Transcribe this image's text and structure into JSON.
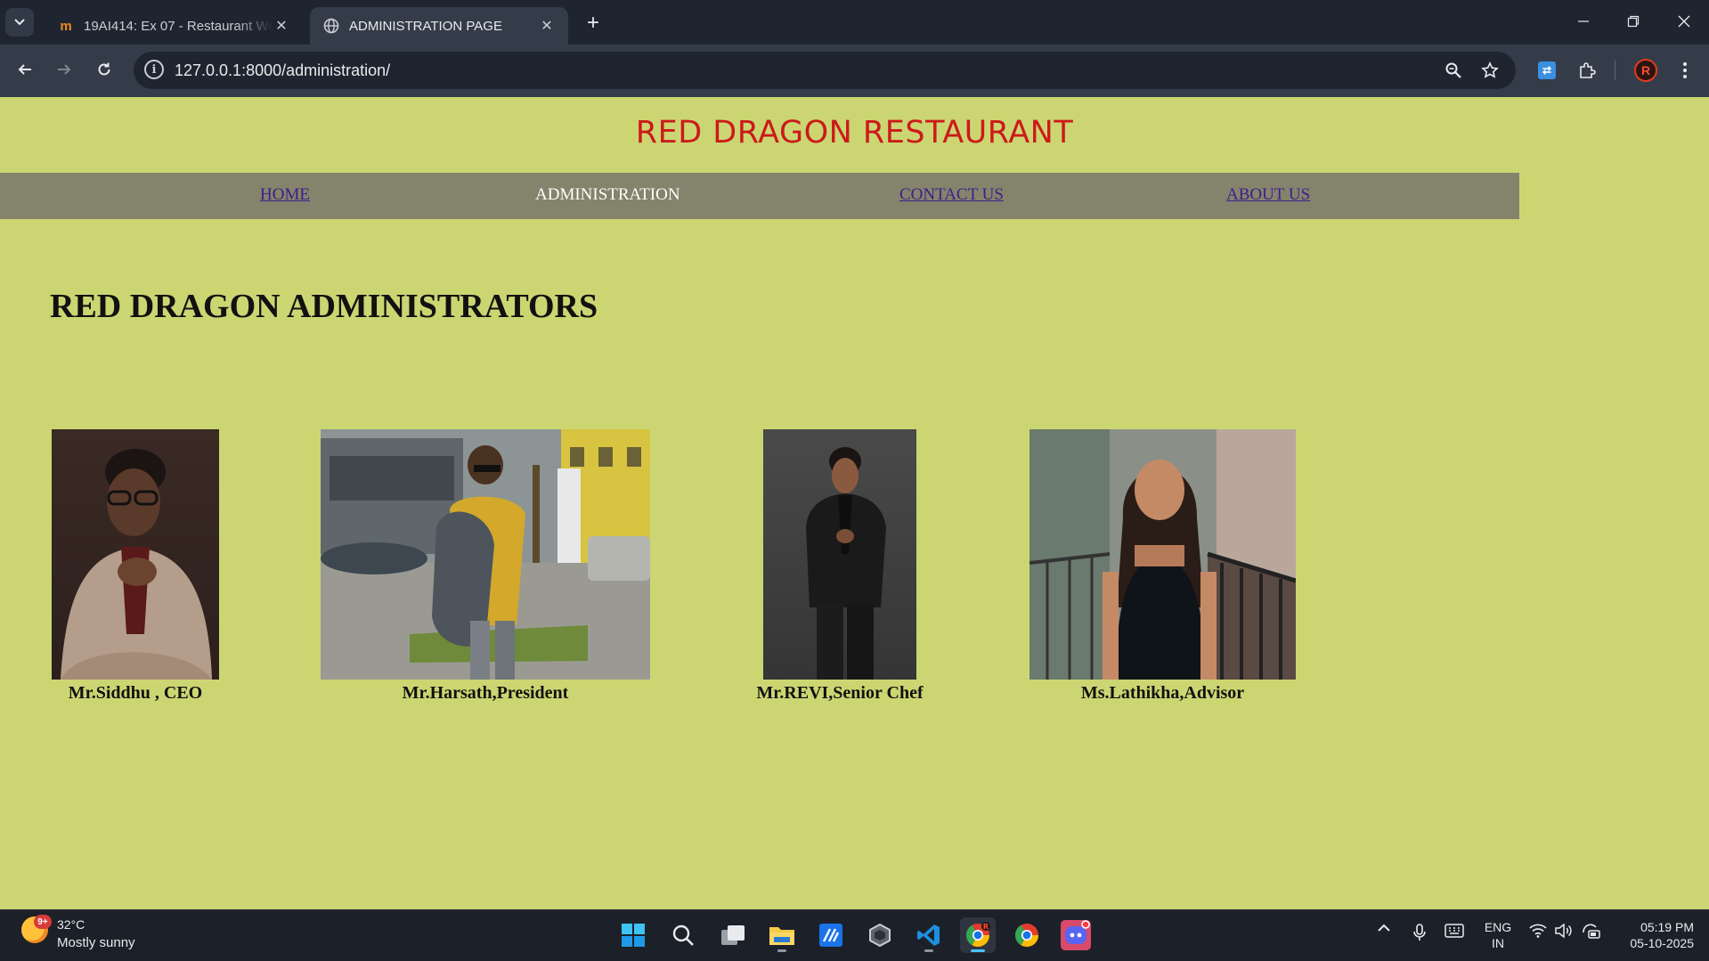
{
  "browser": {
    "tabs": [
      {
        "title": "19AI414: Ex 07 - Restaurant We",
        "favicon": "moodle-icon",
        "active": false
      },
      {
        "title": "ADMINISTRATION PAGE",
        "favicon": "globe-icon",
        "active": true
      }
    ],
    "url": "127.0.0.1:8000/administration/",
    "profile_initial": "R"
  },
  "page": {
    "site_title": "RED DRAGON RESTAURANT",
    "nav": [
      {
        "label": "HOME",
        "current": false
      },
      {
        "label": "ADMINISTRATION",
        "current": true
      },
      {
        "label": "CONTACT US",
        "current": false
      },
      {
        "label": "ABOUT US",
        "current": false
      }
    ],
    "heading": "RED DRAGON ADMINISTRATORS",
    "administrators": [
      {
        "caption": "Mr.Siddhu , CEO"
      },
      {
        "caption": "Mr.Harsath,President"
      },
      {
        "caption": "Mr.REVI,Senior Chef"
      },
      {
        "caption": "Ms.Lathikha,Advisor"
      }
    ],
    "colors": {
      "background": "#cbd672",
      "title": "#cc1a1a",
      "nav_band": "#84836c"
    }
  },
  "taskbar": {
    "weather_temp": "32°C",
    "weather_condition": "Mostly sunny",
    "weather_badge": "9+",
    "language_line1": "ENG",
    "language_line2": "IN",
    "time": "05:19 PM",
    "date": "05-10-2025"
  }
}
